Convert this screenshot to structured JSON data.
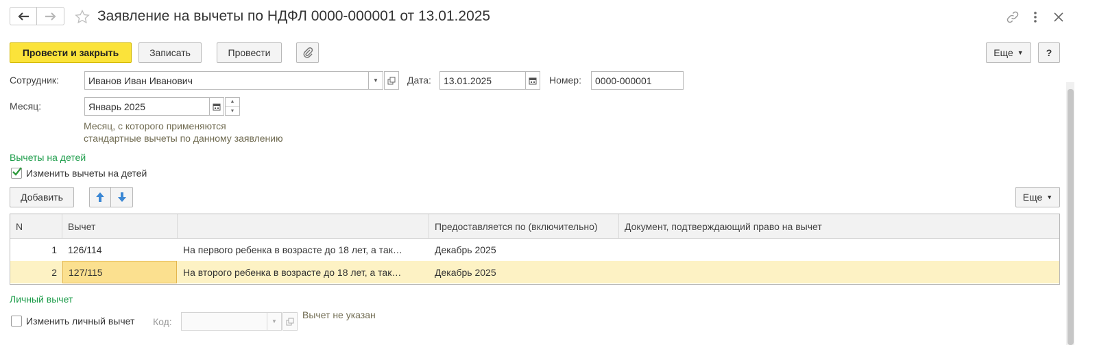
{
  "header": {
    "title": "Заявление на вычеты по НДФЛ 0000-000001 от 13.01.2025"
  },
  "toolbar": {
    "post_close": "Провести и закрыть",
    "save": "Записать",
    "post": "Провести",
    "more": "Еще",
    "help": "?"
  },
  "form": {
    "employee_label": "Сотрудник:",
    "employee_value": "Иванов Иван Иванович",
    "date_label": "Дата:",
    "date_value": "13.01.2025",
    "number_label": "Номер:",
    "number_value": "0000-000001",
    "month_label": "Месяц:",
    "month_value": "Январь 2025",
    "month_hint_1": "Месяц, с которого применяются",
    "month_hint_2": "стандартные вычеты по данному заявлению"
  },
  "children_section": {
    "title": "Вычеты на детей",
    "checkbox_label": "Изменить вычеты на детей",
    "checked": true,
    "add_button": "Добавить",
    "more": "Еще"
  },
  "table": {
    "columns": [
      "N",
      "Вычет",
      "",
      "Предоставляется по (включительно)",
      "Документ, подтверждающий право на вычет"
    ],
    "rows": [
      {
        "n": "1",
        "code": "126/114",
        "desc": "На первого ребенка в возрасте до 18 лет, а так…",
        "until": "Декабрь 2025",
        "doc": ""
      },
      {
        "n": "2",
        "code": "127/115",
        "desc": "На второго ребенка в возрасте до 18 лет, а так…",
        "until": "Декабрь 2025",
        "doc": ""
      }
    ],
    "selected_row": 2
  },
  "personal_section": {
    "title": "Личный вычет",
    "checkbox_label": "Изменить личный вычет",
    "checked": false,
    "code_label": "Код:",
    "code_value": "",
    "status": "Вычет не указан"
  },
  "colors": {
    "primary_button": "#fbe33a",
    "section_title": "#1e9d4b",
    "hint": "#6f6a50",
    "selected_row": "#fdf2c4",
    "check": "#2e9a3c"
  },
  "icons": {
    "back": "arrow-left-icon",
    "forward": "arrow-right-icon",
    "favorite": "star-icon",
    "link": "link-icon",
    "menu": "kebab-icon",
    "close": "close-icon",
    "attach": "paperclip-icon",
    "dropdown": "chevron-down-icon",
    "open": "open-form-icon",
    "calendar": "calendar-icon",
    "up": "arrow-up-icon",
    "down": "arrow-down-icon"
  }
}
